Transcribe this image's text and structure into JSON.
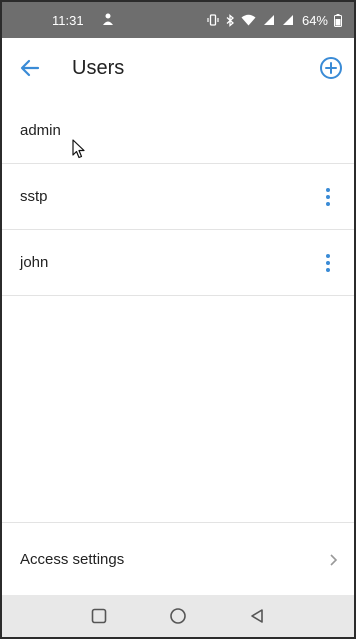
{
  "status_bar": {
    "time": "11:31",
    "battery": "64%"
  },
  "app_bar": {
    "title": "Users"
  },
  "users": [
    {
      "name": "admin",
      "has_menu": false
    },
    {
      "name": "sstp",
      "has_menu": true
    },
    {
      "name": "john",
      "has_menu": true
    }
  ],
  "access": {
    "label": "Access settings"
  },
  "colors": {
    "accent": "#3a8bd6",
    "status_bar_bg": "#6e6e6e",
    "nav_bar_bg": "#e8e8e8"
  },
  "icons": {
    "back": "arrow-left-icon",
    "add": "add-circle-icon",
    "menu": "more-vertical-icon",
    "chevron": "chevron-right-icon",
    "nav": [
      "square-recent-icon",
      "circle-home-icon",
      "triangle-back-icon"
    ]
  }
}
